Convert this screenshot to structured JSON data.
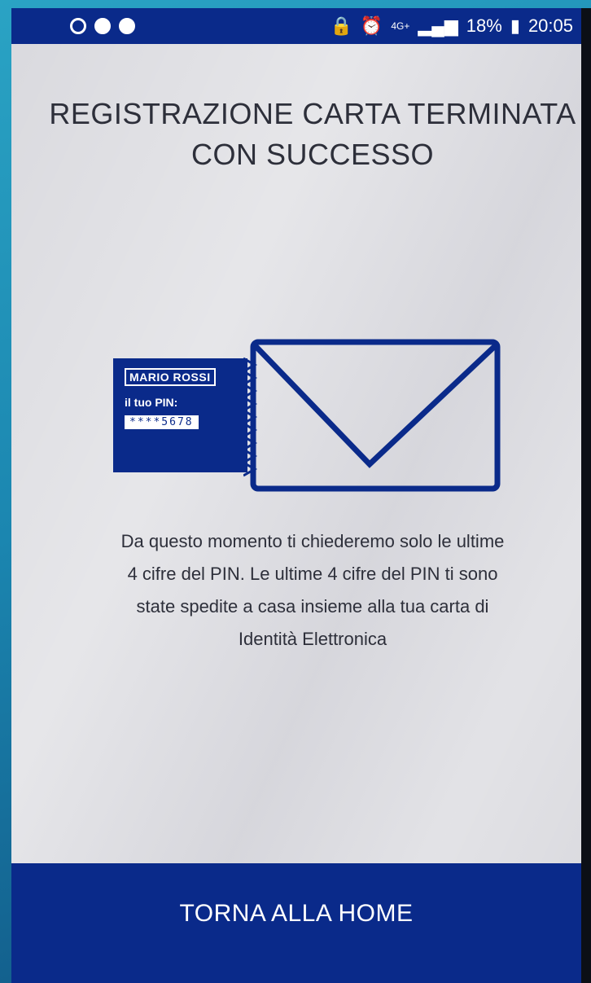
{
  "status_bar": {
    "left_icons": [
      "blocked-icon",
      "chat-icon",
      "chat-icon"
    ],
    "right_icons": [
      "lock-icon",
      "alarm-icon"
    ],
    "network": "4G+",
    "battery": "18%",
    "time": "20:05"
  },
  "title": {
    "line1": "REGISTRAZIONE CARTA TERMINATA",
    "line2": "CON SUCCESSO"
  },
  "card": {
    "name": "MARIO ROSSI",
    "pin_label": "il tuo PIN:",
    "pin_value": "****5678"
  },
  "message": {
    "line1": "Da questo momento ti chiederemo solo le ultime",
    "line2": "4 cifre del PIN. Le ultime 4 cifre del PIN ti sono",
    "line3": "state spedite a casa insieme alla tua carta di",
    "line4": "Identità Elettronica"
  },
  "home_button": {
    "label": "TORNA ALLA HOME"
  },
  "colors": {
    "brand_blue": "#0a2a8a",
    "text": "#2d2f3a"
  }
}
